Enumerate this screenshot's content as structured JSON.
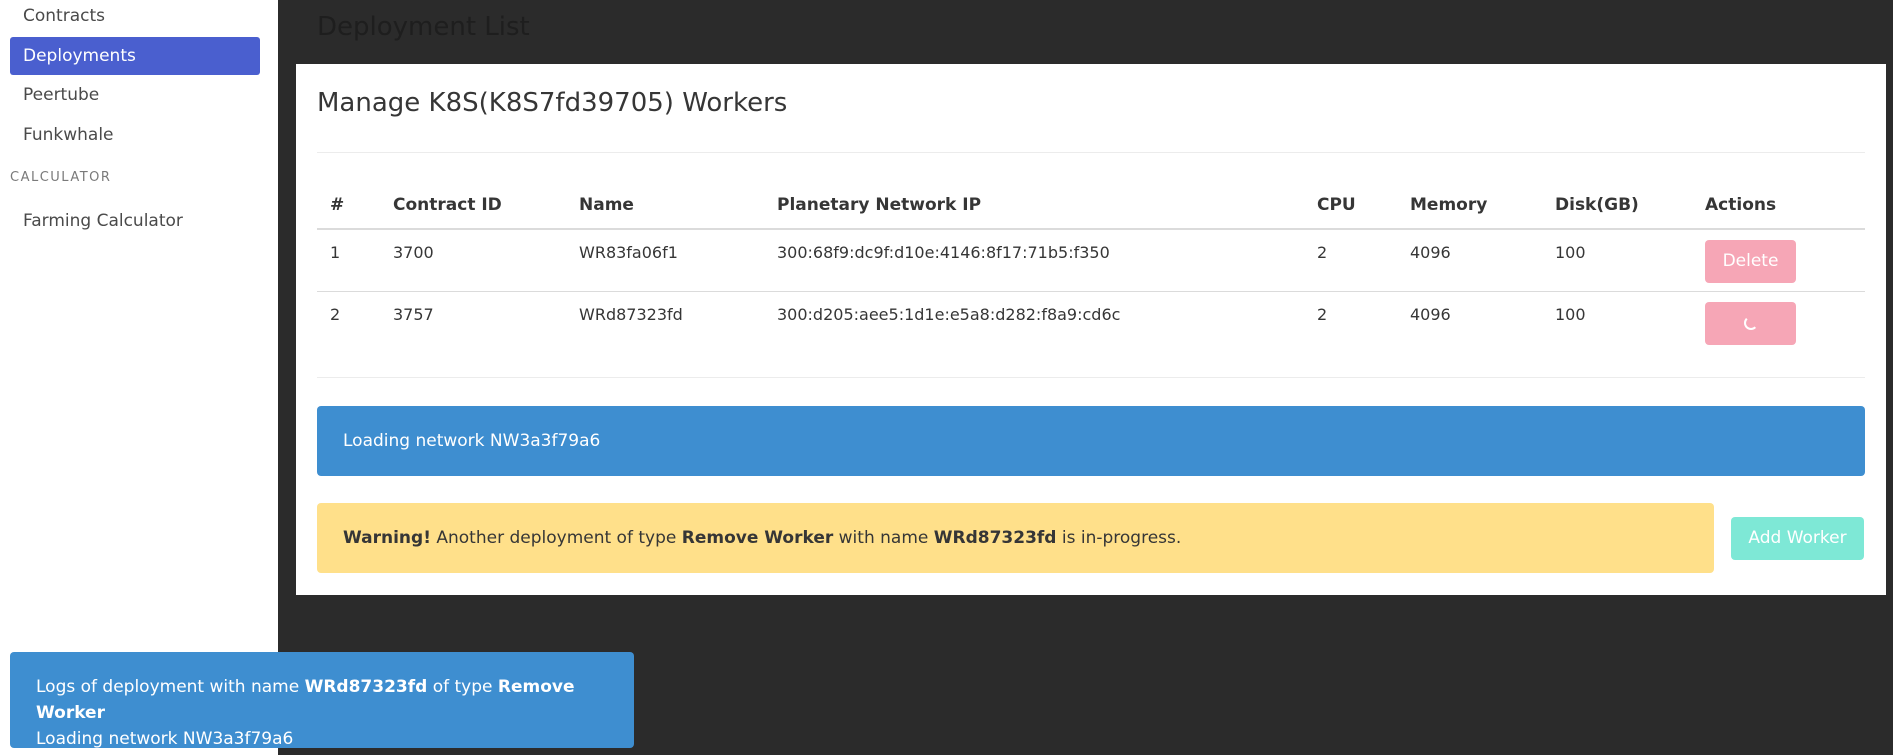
{
  "sidebar": {
    "items": [
      {
        "label": "Contracts"
      },
      {
        "label": "Deployments"
      },
      {
        "label": "Peertube"
      },
      {
        "label": "Funkwhale"
      }
    ],
    "section_label": "CALCULATOR",
    "calculator_item": "Farming Calculator"
  },
  "page": {
    "title": "Deployment List"
  },
  "card": {
    "title": "Manage K8S(K8S7fd39705) Workers",
    "table": {
      "headers": [
        "#",
        "Contract ID",
        "Name",
        "Planetary Network IP",
        "CPU",
        "Memory",
        "Disk(GB)",
        "Actions"
      ],
      "rows": [
        {
          "idx": "1",
          "contract_id": "3700",
          "name": "WR83fa06f1",
          "ip": "300:68f9:dc9f:d10e:4146:8f17:71b5:f350",
          "cpu": "2",
          "memory": "4096",
          "disk": "100",
          "action": "Delete"
        },
        {
          "idx": "2",
          "contract_id": "3757",
          "name": "WRd87323fd",
          "ip": "300:d205:aee5:1d1e:e5a8:d282:f8a9:cd6c",
          "cpu": "2",
          "memory": "4096",
          "disk": "100",
          "action": ""
        }
      ]
    },
    "info_message": "Loading network NW3a3f79a6",
    "warning": {
      "prefix": "Warning!",
      "text1": " Another deployment of type ",
      "type": "Remove Worker",
      "text2": " with name ",
      "name": "WRd87323fd",
      "text3": " is in-progress."
    },
    "add_button": "Add Worker"
  },
  "toast": {
    "text1": "Logs of deployment with name ",
    "name": "WRd87323fd",
    "text2": " of type ",
    "type": "Remove Worker",
    "line2": "Loading network NW3a3f79a6"
  },
  "colors": {
    "sidebar_active": "#4a5fcf",
    "info": "#3e8ed0",
    "warning": "#ffe08a",
    "danger_light": "#f6a6b6",
    "success_light": "#7ee8d6",
    "background_dark": "#2b2b2b"
  }
}
